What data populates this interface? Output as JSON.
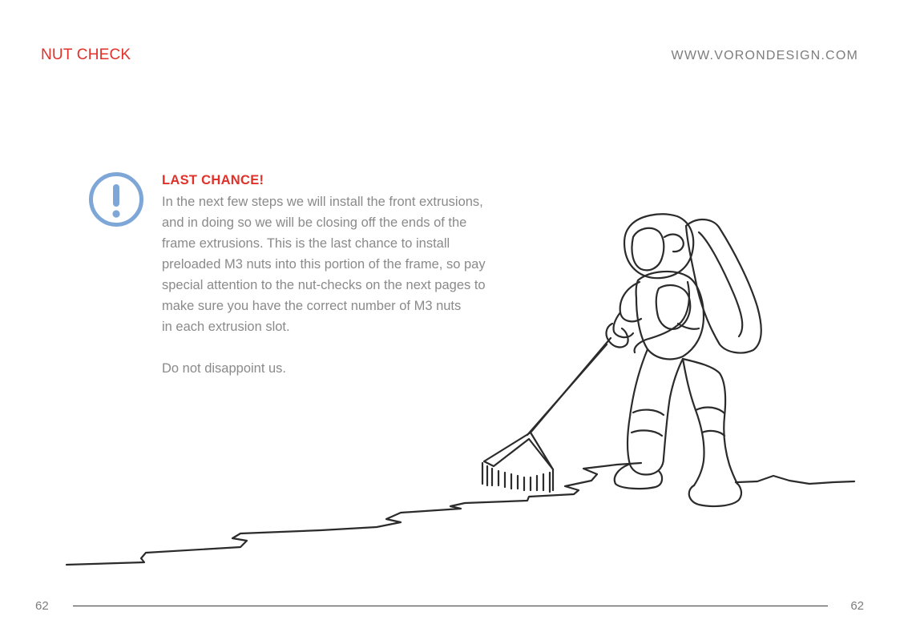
{
  "header": {
    "section_title": "NUT CHECK",
    "site_url": "WWW.VORONDESIGN.COM"
  },
  "callout": {
    "icon": "exclamation-circle-icon",
    "icon_color": "#7ea7d8",
    "heading": "LAST CHANCE!",
    "heading_color": "#e0312a",
    "body_lines": [
      "In the next few steps we will install the front extrusions,",
      "and in doing so we will be closing off the ends of the",
      "frame extrusions. This is the last chance to install",
      "preloaded M3 nuts into this portion of the frame, so pay",
      "special attention to the nut-checks on the next pages to",
      "make sure you have the correct number of M3 nuts",
      "in each extrusion slot."
    ],
    "closing": "Do not disappoint us."
  },
  "illustration": {
    "name": "astronaut-raking-line-art"
  },
  "footer": {
    "page_left": "62",
    "page_right": "62"
  }
}
